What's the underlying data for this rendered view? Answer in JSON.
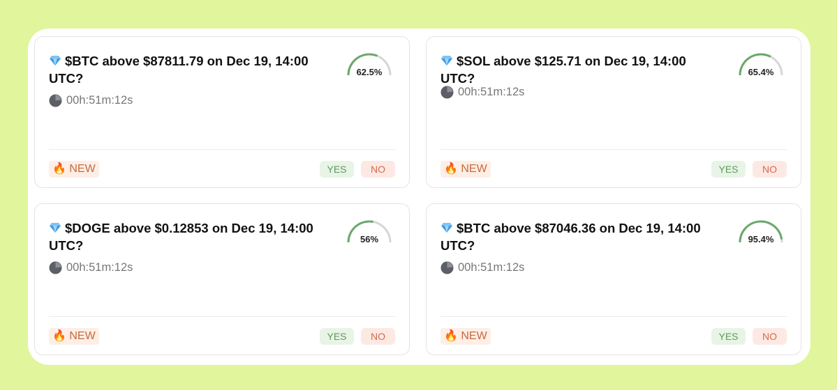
{
  "cards": [
    {
      "title": "$BTC above $87811.79 on Dec 19, 14:00 UTC?",
      "percent_label": "62.5%",
      "percent": 62.5,
      "timer": "00h:51m:12s",
      "badge": "🔥 NEW",
      "yes": "YES",
      "no": "NO"
    },
    {
      "title": "$SOL above $125.71 on Dec 19, 14:00 UTC?",
      "percent_label": "65.4%",
      "percent": 65.4,
      "timer": "00h:51m:12s",
      "badge": "🔥 NEW",
      "yes": "YES",
      "no": "NO"
    },
    {
      "title": "$DOGE above $0.12853 on Dec 19, 14:00 UTC?",
      "percent_label": "56%",
      "percent": 56,
      "timer": "00h:51m:12s",
      "badge": "🔥 NEW",
      "yes": "YES",
      "no": "NO"
    },
    {
      "title": "$BTC above $87046.36 on Dec 19, 14:00 UTC?",
      "percent_label": "95.4%",
      "percent": 95.4,
      "timer": "00h:51m:12s",
      "badge": "🔥 NEW",
      "yes": "YES",
      "no": "NO"
    }
  ],
  "colors": {
    "background": "#e1f59c",
    "gauge_fill": "#6aa86a",
    "gauge_track": "#d6d6d6",
    "no_text": "#d56a4c",
    "yes_text": "#5f9a5b"
  },
  "icons": {
    "title_icon": "gem-icon",
    "timer_icon": "clock-icon",
    "badge_icon": "fire-icon"
  }
}
